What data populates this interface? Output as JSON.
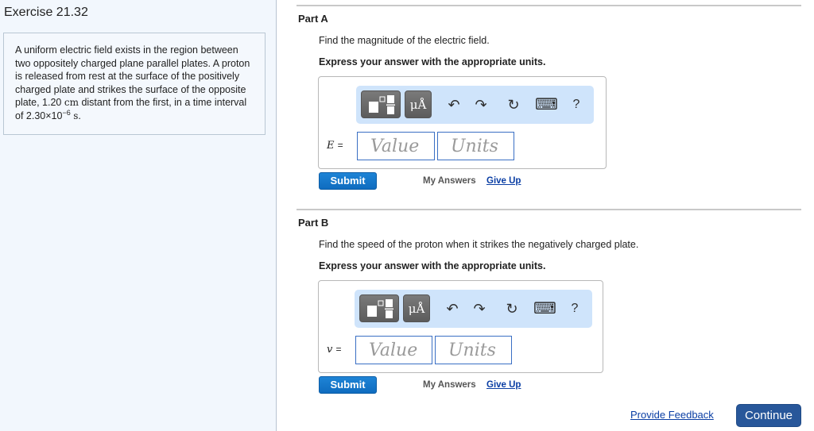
{
  "sidebar": {
    "exercise_title": "Exercise 21.32",
    "problem": {
      "text_before_distance": "A uniform electric field exists in the region between two oppositely charged plane parallel plates. A proton is released from rest at the surface of the positively charged plate and strikes the surface of the opposite plate, 1.20 ",
      "distance_unit": "cm",
      "text_after_distance": " distant from the first, in a time interval of 2.30×10",
      "time_exponent": "−6",
      "time_unit": "s",
      "end": "."
    }
  },
  "parts": [
    {
      "title": "Part A",
      "question": "Find the magnitude of the electric field.",
      "instruction": "Express your answer with the appropriate units.",
      "variable": "E",
      "equals": "=",
      "value_placeholder": "Value",
      "units_placeholder": "Units",
      "submit_label": "Submit",
      "my_answers_label": "My Answers",
      "give_up_label": "Give Up"
    },
    {
      "title": "Part B",
      "question": "Find the speed of the proton when it strikes the negatively charged plate.",
      "instruction": "Express your answer with the appropriate units.",
      "variable": "v",
      "equals": "=",
      "value_placeholder": "Value",
      "units_placeholder": "Units",
      "submit_label": "Submit",
      "my_answers_label": "My Answers",
      "give_up_label": "Give Up"
    }
  ],
  "toolbar": {
    "templates_icon": "templates-icon",
    "units_label": "μÅ",
    "undo_glyph": "↶",
    "redo_glyph": "↷",
    "reset_glyph": "↻",
    "keyboard_glyph": "⌨",
    "help_glyph": "?"
  },
  "footer": {
    "feedback_label": "Provide Feedback",
    "continue_label": "Continue"
  },
  "colors": {
    "sidebar_bg": "#f2f7fd",
    "toolbar_bg": "#cfe4fb",
    "submit_bg": "#1479cc",
    "continue_bg": "#28579a",
    "link": "#0a3ea4",
    "field_border": "#3a6fc4"
  }
}
